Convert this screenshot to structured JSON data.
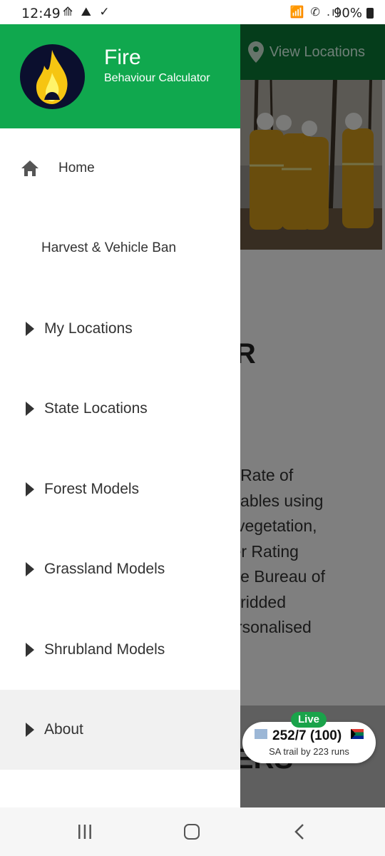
{
  "status_bar": {
    "time": "12:49",
    "left_icons": "⟰ ⛰ ✓",
    "right_icons": "📶 ✆ .ıl",
    "battery": "90%"
  },
  "background": {
    "view_locations": "View Locations",
    "heading_fragment": "UR",
    "paragraph": "ex, Rate of\nvariables using\nan vegetation,\nnger Rating\ns the Bureau of\nst gridded\n personalised",
    "partners_fragment": "NERS"
  },
  "live_score": {
    "badge": "Live",
    "score": "252/7 (100)",
    "status": "SA trail by 223 runs"
  },
  "drawer": {
    "title": "Fire",
    "subtitle": "Behaviour Calculator",
    "items": [
      {
        "label": "Home"
      },
      {
        "label": "Harvest & Vehicle Ban"
      },
      {
        "label": "My Locations"
      },
      {
        "label": "State Locations"
      },
      {
        "label": "Forest Models"
      },
      {
        "label": "Grassland Models"
      },
      {
        "label": "Shrubland Models"
      },
      {
        "label": "About"
      }
    ]
  },
  "colors": {
    "drawer_header": "#10a84e",
    "app_header": "#0b7a36",
    "live_badge": "#1aa34a"
  },
  "icons": [
    "home-icon",
    "caret-right-icon",
    "map-pin-icon",
    "recent-apps-icon",
    "home-button-icon",
    "back-icon"
  ]
}
